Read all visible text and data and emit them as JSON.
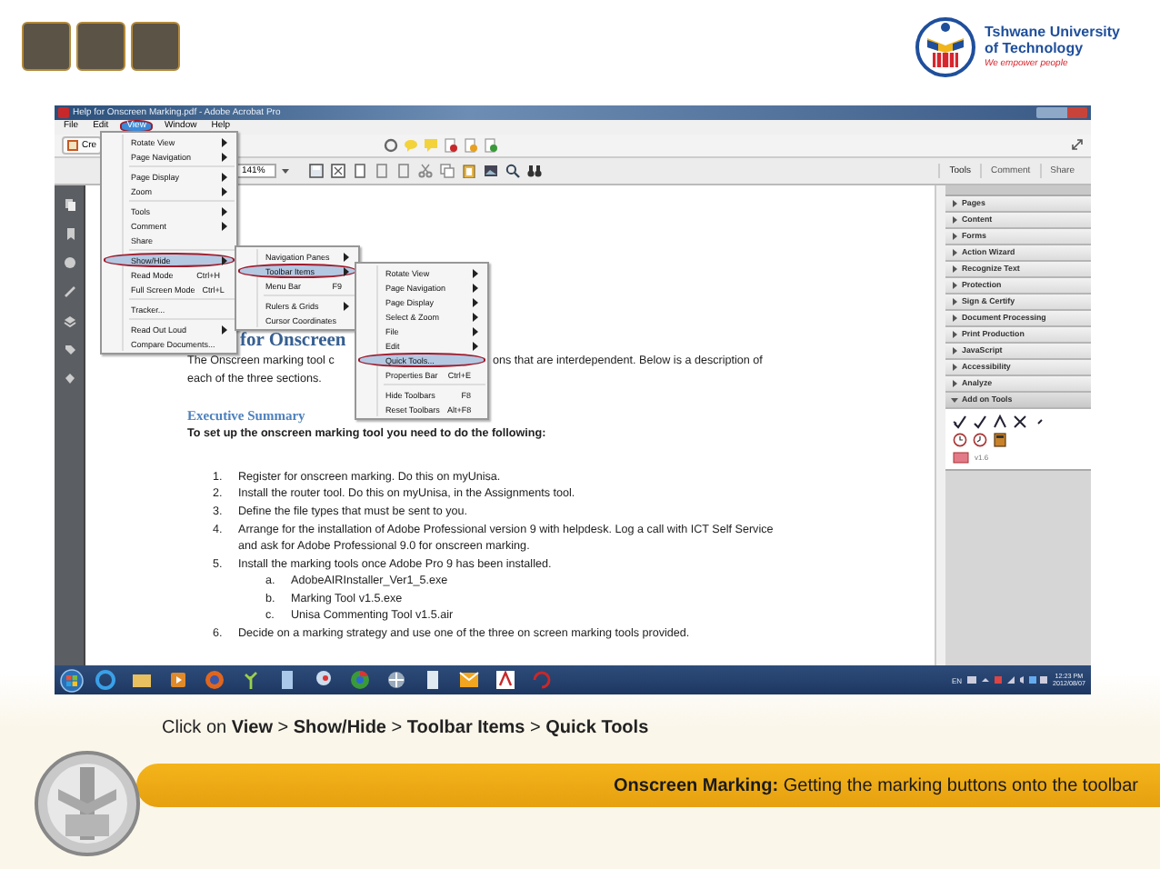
{
  "header": {
    "logo": {
      "name_lines": [
        "Tshwane University",
        "of Technology"
      ],
      "tagline": "We empower people"
    }
  },
  "app": {
    "title": "Help for Onscreen Marking.pdf - Adobe Acrobat Pro",
    "menubar": [
      {
        "label": "File",
        "selected": false
      },
      {
        "label": "Edit",
        "selected": false
      },
      {
        "label": "View",
        "selected": true
      },
      {
        "label": "Window",
        "selected": false
      },
      {
        "label": "Help",
        "selected": false
      }
    ],
    "create_label": "Cre",
    "zoom": "141%",
    "panel_tabs": [
      {
        "label": "Tools",
        "selected": true
      },
      {
        "label": "Comment",
        "selected": false
      },
      {
        "label": "Share",
        "selected": false
      }
    ],
    "menus": [
      {
        "items": [
          {
            "kind": "item",
            "label": "Rotate View",
            "submenu": true,
            "highlighted": false
          },
          {
            "kind": "item",
            "label": "Page Navigation",
            "submenu": true,
            "highlighted": false
          },
          {
            "kind": "separator"
          },
          {
            "kind": "item",
            "label": "Page Display",
            "submenu": true,
            "highlighted": false
          },
          {
            "kind": "item",
            "label": "Zoom",
            "submenu": true,
            "highlighted": false
          },
          {
            "kind": "separator"
          },
          {
            "kind": "item",
            "label": "Tools",
            "submenu": true,
            "highlighted": false
          },
          {
            "kind": "item",
            "label": "Comment",
            "submenu": true,
            "highlighted": false
          },
          {
            "kind": "item",
            "label": "Share",
            "submenu": false,
            "highlighted": false
          },
          {
            "kind": "separator"
          },
          {
            "kind": "item",
            "label": "Show/Hide",
            "submenu": true,
            "highlighted": true
          },
          {
            "kind": "item",
            "label": "Read Mode",
            "shortcut": "Ctrl+H",
            "submenu": false,
            "highlighted": false
          },
          {
            "kind": "item",
            "label": "Full Screen Mode",
            "shortcut": "Ctrl+L",
            "submenu": false,
            "highlighted": false
          },
          {
            "kind": "separator"
          },
          {
            "kind": "item",
            "label": "Tracker...",
            "submenu": false,
            "highlighted": false
          },
          {
            "kind": "separator"
          },
          {
            "kind": "item",
            "label": "Read Out Loud",
            "submenu": true,
            "highlighted": false
          },
          {
            "kind": "item",
            "label": "Compare Documents...",
            "submenu": false,
            "highlighted": false
          }
        ]
      },
      {
        "items": [
          {
            "kind": "item",
            "label": "Navigation Panes",
            "submenu": true,
            "highlighted": false
          },
          {
            "kind": "item",
            "label": "Toolbar Items",
            "submenu": true,
            "highlighted": true
          },
          {
            "kind": "item",
            "label": "Menu Bar",
            "shortcut": "F9",
            "submenu": false,
            "highlighted": false
          },
          {
            "kind": "separator"
          },
          {
            "kind": "item",
            "label": "Rulers & Grids",
            "submenu": true,
            "highlighted": false
          },
          {
            "kind": "item",
            "label": "Cursor Coordinates",
            "submenu": false,
            "highlighted": false
          }
        ]
      },
      {
        "items": [
          {
            "kind": "item",
            "label": "Rotate View",
            "submenu": true,
            "highlighted": false
          },
          {
            "kind": "item",
            "label": "Page Navigation",
            "submenu": true,
            "highlighted": false
          },
          {
            "kind": "item",
            "label": "Page Display",
            "submenu": true,
            "highlighted": false
          },
          {
            "kind": "item",
            "label": "Select & Zoom",
            "submenu": true,
            "highlighted": false
          },
          {
            "kind": "item",
            "label": "File",
            "submenu": true,
            "highlighted": false
          },
          {
            "kind": "item",
            "label": "Edit",
            "submenu": true,
            "highlighted": false
          },
          {
            "kind": "item",
            "label": "Quick Tools...",
            "submenu": false,
            "highlighted": true
          },
          {
            "kind": "item",
            "label": "Properties Bar",
            "shortcut": "Ctrl+E",
            "submenu": false,
            "highlighted": false
          },
          {
            "kind": "separator"
          },
          {
            "kind": "item",
            "label": "Hide Toolbars",
            "shortcut": "F8",
            "submenu": false,
            "highlighted": false
          },
          {
            "kind": "item",
            "label": "Reset Toolbars",
            "shortcut": "Alt+F8",
            "submenu": false,
            "highlighted": false
          }
        ]
      }
    ],
    "document": {
      "heading": "for Onscreen",
      "intro_before": "The Onscreen marking tool c",
      "intro_after": "ons that are interdependent.  Below is a description of",
      "intro_line2": "each of the three sections.",
      "section_title": "Executive Summary",
      "lead": "To set up the onscreen marking tool you need to do the following:",
      "steps": [
        {
          "number": "1.",
          "text": "Register for onscreen marking.  Do this on myUnisa."
        },
        {
          "number": "2.",
          "text": "Install the router tool.  Do this on myUnisa, in the Assignments tool."
        },
        {
          "number": "3.",
          "text": "Define the file types that must be sent to you."
        },
        {
          "number": "4.",
          "text": "Arrange for the installation of Adobe Professional version 9 with helpdesk.  Log a call with ICT Self Service and ask for Adobe Professional 9.0 for onscreen marking."
        },
        {
          "number": "5.",
          "text": "Install the marking tools once Adobe Pro 9 has been installed.",
          "children": [
            {
              "number": "a.",
              "text": "AdobeAIRInstaller_Ver1_5.exe"
            },
            {
              "number": "b.",
              "text": "Marking Tool v1.5.exe"
            },
            {
              "number": "c.",
              "text": "Unisa Commenting Tool v1.5.air"
            }
          ]
        },
        {
          "number": "6.",
          "text": "Decide on a marking strategy and use one of the three on screen marking tools provided."
        }
      ]
    },
    "tools_panel": {
      "sections": [
        {
          "label": "Pages",
          "expanded": false
        },
        {
          "label": "Content",
          "expanded": false
        },
        {
          "label": "Forms",
          "expanded": false
        },
        {
          "label": "Action Wizard",
          "expanded": false
        },
        {
          "label": "Recognize Text",
          "expanded": false
        },
        {
          "label": "Protection",
          "expanded": false
        },
        {
          "label": "Sign & Certify",
          "expanded": false
        },
        {
          "label": "Document Processing",
          "expanded": false
        },
        {
          "label": "Print Production",
          "expanded": false
        },
        {
          "label": "JavaScript",
          "expanded": false
        },
        {
          "label": "Accessibility",
          "expanded": false
        },
        {
          "label": "Analyze",
          "expanded": false
        },
        {
          "label": "Add on Tools",
          "expanded": true
        }
      ],
      "addon_version": "v1.6"
    },
    "taskbar": {
      "language": "EN",
      "time": "12:23 PM",
      "date": "2012/08/07"
    }
  },
  "caption": "Click on **View** > **Show/Hide** > **Toolbar Items** > **Quick Tools**",
  "banner": "**Onscreen Marking:** Getting the marking buttons onto the toolbar"
}
